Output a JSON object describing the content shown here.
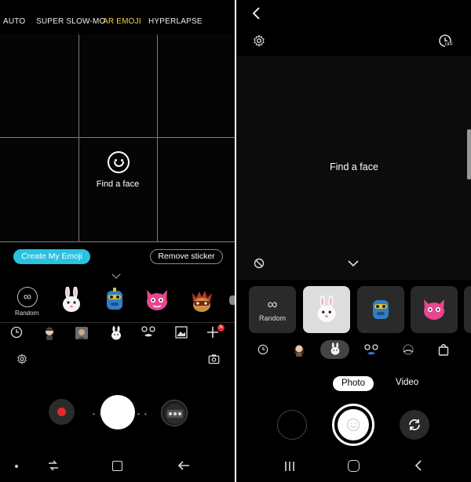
{
  "left": {
    "modes": [
      "AUTO",
      "SUPER SLOW-MO",
      "AR EMOJI",
      "HYPERLAPSE"
    ],
    "active_mode": "AR EMOJI",
    "find_face_text": "Find a face",
    "create_button": "Create My Emoji",
    "remove_button": "Remove sticker",
    "random_label": "Random",
    "emoji_items": [
      "bunny-emoji",
      "robot-emoji",
      "pink-cat-emoji",
      "masquerade-emoji"
    ],
    "sticker_badge": "N",
    "colors": {
      "accent": "#29c2e0",
      "active_mode": "#f3d34a",
      "record": "#e8262b"
    }
  },
  "right": {
    "find_face_text": "Find a face",
    "random_label": "Random",
    "mode_photo": "Photo",
    "mode_video": "Video",
    "timer_label": "OFF"
  }
}
